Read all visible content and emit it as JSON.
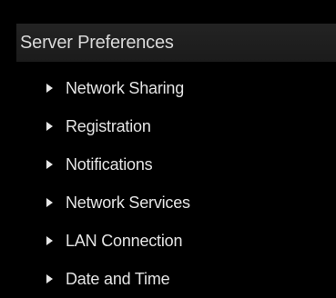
{
  "panel": {
    "title": "Server Preferences",
    "items": [
      {
        "label": "Network Sharing",
        "icon": "triangle-right-icon"
      },
      {
        "label": "Registration",
        "icon": "triangle-right-icon"
      },
      {
        "label": "Notifications",
        "icon": "triangle-right-icon"
      },
      {
        "label": "Network Services",
        "icon": "triangle-right-icon"
      },
      {
        "label": "LAN Connection",
        "icon": "triangle-right-icon"
      },
      {
        "label": "Date and Time",
        "icon": "triangle-right-icon"
      }
    ]
  },
  "colors": {
    "background": "#000000",
    "header_background": "#1f1f1f",
    "text": "#e4e4e4"
  }
}
